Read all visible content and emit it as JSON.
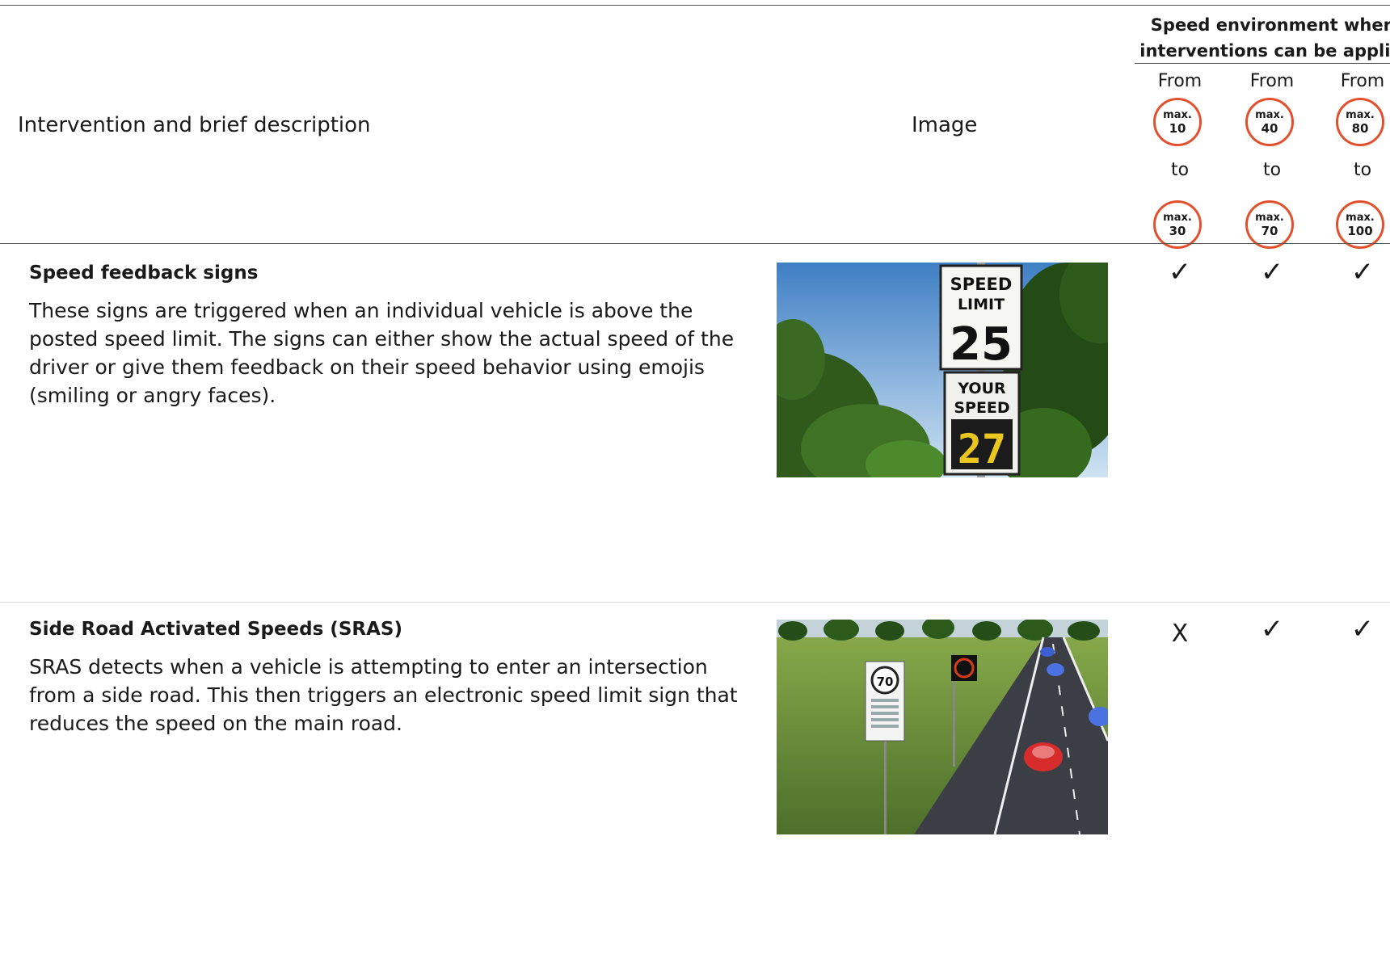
{
  "header": {
    "desc_col_label": "Intervention and brief description",
    "image_col_label": "Image",
    "group_title_line1": "Speed environment where",
    "group_title_line2": "interventions can be applied",
    "from_word": "From",
    "to_word": "to",
    "badge_prefix": "max.",
    "ranges": [
      {
        "from": "10",
        "to": "30"
      },
      {
        "from": "40",
        "to": "70"
      },
      {
        "from": "80",
        "to": "100"
      }
    ]
  },
  "rows": [
    {
      "title": "Speed feedback signs",
      "description": "These signs are triggered when an individual vehicle is above the posted speed limit. The signs can either show the actual speed of the driver or give them feedback on their speed behavior using emojis (smiling or angry faces).",
      "image_text": {
        "sign_line1": "SPEED",
        "sign_line2": "LIMIT",
        "sign_value": "25",
        "display_line1": "YOUR",
        "display_line2": "SPEED",
        "display_value": "27"
      },
      "applicability": [
        "✓",
        "✓",
        "✓"
      ]
    },
    {
      "title": "Side Road Activated Speeds (SRAS)",
      "description": "SRAS detects when a vehicle is attempting to enter an intersection from a side road. This then triggers an electronic speed limit sign that reduces the speed on the main road.",
      "image_text": {
        "sign_value": "70"
      },
      "applicability": [
        "X",
        "✓",
        "✓"
      ]
    }
  ],
  "colors": {
    "badge_ring": "#e2502d"
  },
  "icons": {
    "applies": "check-icon",
    "not_applies": "cross-mark"
  }
}
